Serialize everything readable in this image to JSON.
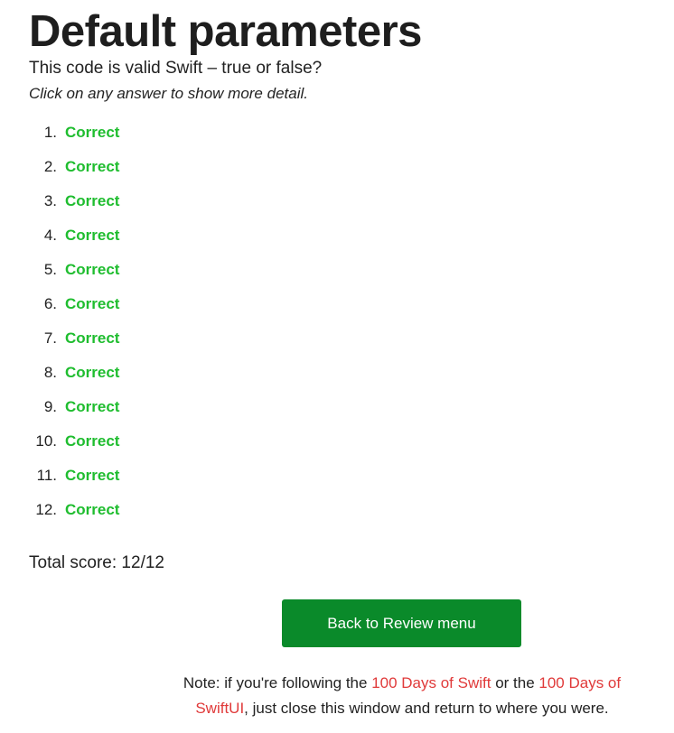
{
  "page": {
    "title": "Default parameters",
    "question": "This code is valid Swift – true or false?",
    "instruction": "Click on any answer to show more detail."
  },
  "answers": [
    {
      "number": "1.",
      "result": "Correct"
    },
    {
      "number": "2.",
      "result": "Correct"
    },
    {
      "number": "3.",
      "result": "Correct"
    },
    {
      "number": "4.",
      "result": "Correct"
    },
    {
      "number": "5.",
      "result": "Correct"
    },
    {
      "number": "6.",
      "result": "Correct"
    },
    {
      "number": "7.",
      "result": "Correct"
    },
    {
      "number": "8.",
      "result": "Correct"
    },
    {
      "number": "9.",
      "result": "Correct"
    },
    {
      "number": "10.",
      "result": "Correct"
    },
    {
      "number": "11.",
      "result": "Correct"
    },
    {
      "number": "12.",
      "result": "Correct"
    }
  ],
  "score": {
    "text": "Total score: 12/12"
  },
  "back_button": {
    "label": "Back to Review menu"
  },
  "note": {
    "part1": "Note: if you're following the ",
    "link1": "100 Days of Swift",
    "part2": " or the ",
    "link2": "100 Days of SwiftUI",
    "part3": ", just close this window and return to where you were."
  },
  "colors": {
    "correct": "#1fbd2f",
    "button_bg": "#0a8a2a",
    "link": "#e03a3a"
  }
}
